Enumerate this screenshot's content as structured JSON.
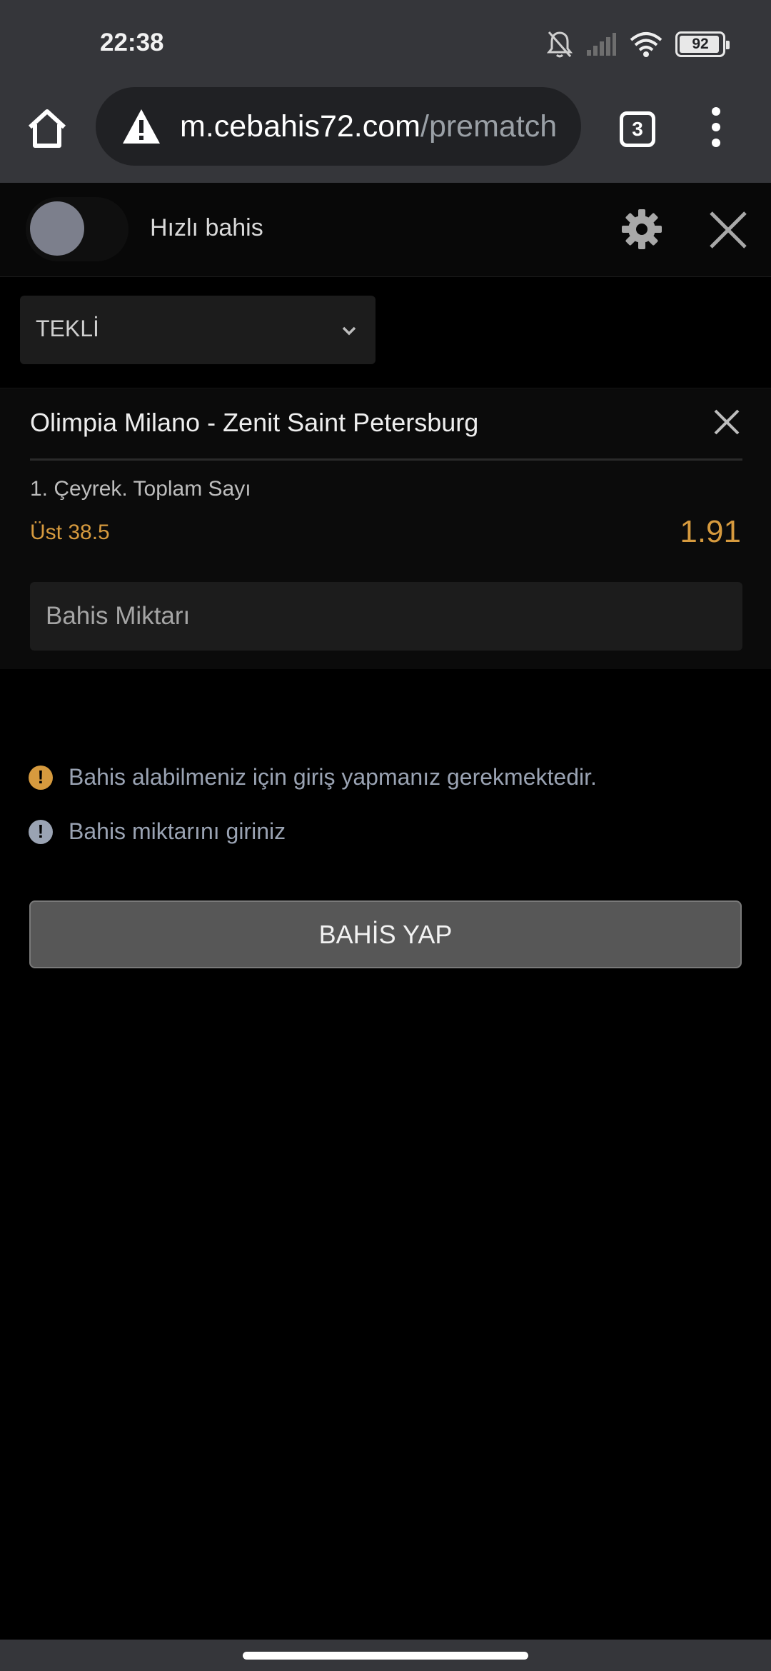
{
  "status_bar": {
    "time": "22:38",
    "battery": "92",
    "icons": [
      "bell-off-icon",
      "signal-icon",
      "wifi-icon",
      "battery-icon"
    ]
  },
  "browser": {
    "url_domain": "m.cebahis72.com",
    "url_path": "/prematch",
    "tab_count": "3",
    "icons": [
      "home-icon",
      "warning-icon",
      "tabs-icon",
      "more-vert-icon"
    ]
  },
  "quick_bet": {
    "label": "Hızlı bahis",
    "toggle_on": false
  },
  "bet_type": {
    "selected": "TEKLİ"
  },
  "bet_slip": {
    "match": "Olimpia Milano - Zenit Saint Petersburg",
    "market": "1. Çeyrek. Toplam Sayı",
    "selection": "Üst 38.5",
    "odds": "1.91",
    "stake_placeholder": "Bahis Miktarı"
  },
  "messages": [
    {
      "text": "Bahis alabilmeniz için giriş yapmanız gerekmektedir.",
      "color": "#d69a3e"
    },
    {
      "text": "Bahis miktarını giriniz",
      "color": "#9aa3b3"
    }
  ],
  "submit_label": "BAHİS YAP",
  "colors": {
    "accent": "#d69a3e",
    "background": "#000000",
    "chrome": "#35363a"
  }
}
